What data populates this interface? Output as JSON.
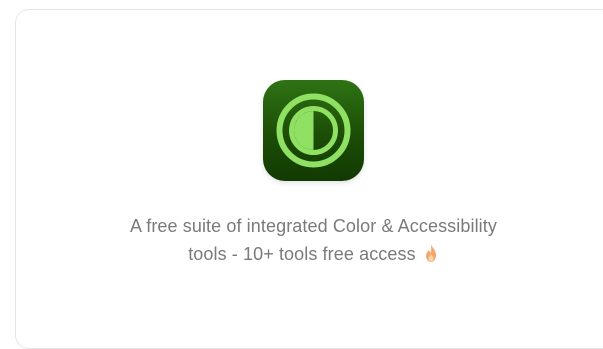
{
  "card": {
    "description_line1": "A free suite of integrated Color & Accessibility",
    "description_line2": "tools - 10+ tools free access",
    "emoji_icon": "fire-icon"
  },
  "icon": {
    "name": "contrast-icon",
    "background_top": "#2f7314",
    "background_bottom": "#123a02",
    "ring_color": "#8fe063"
  }
}
